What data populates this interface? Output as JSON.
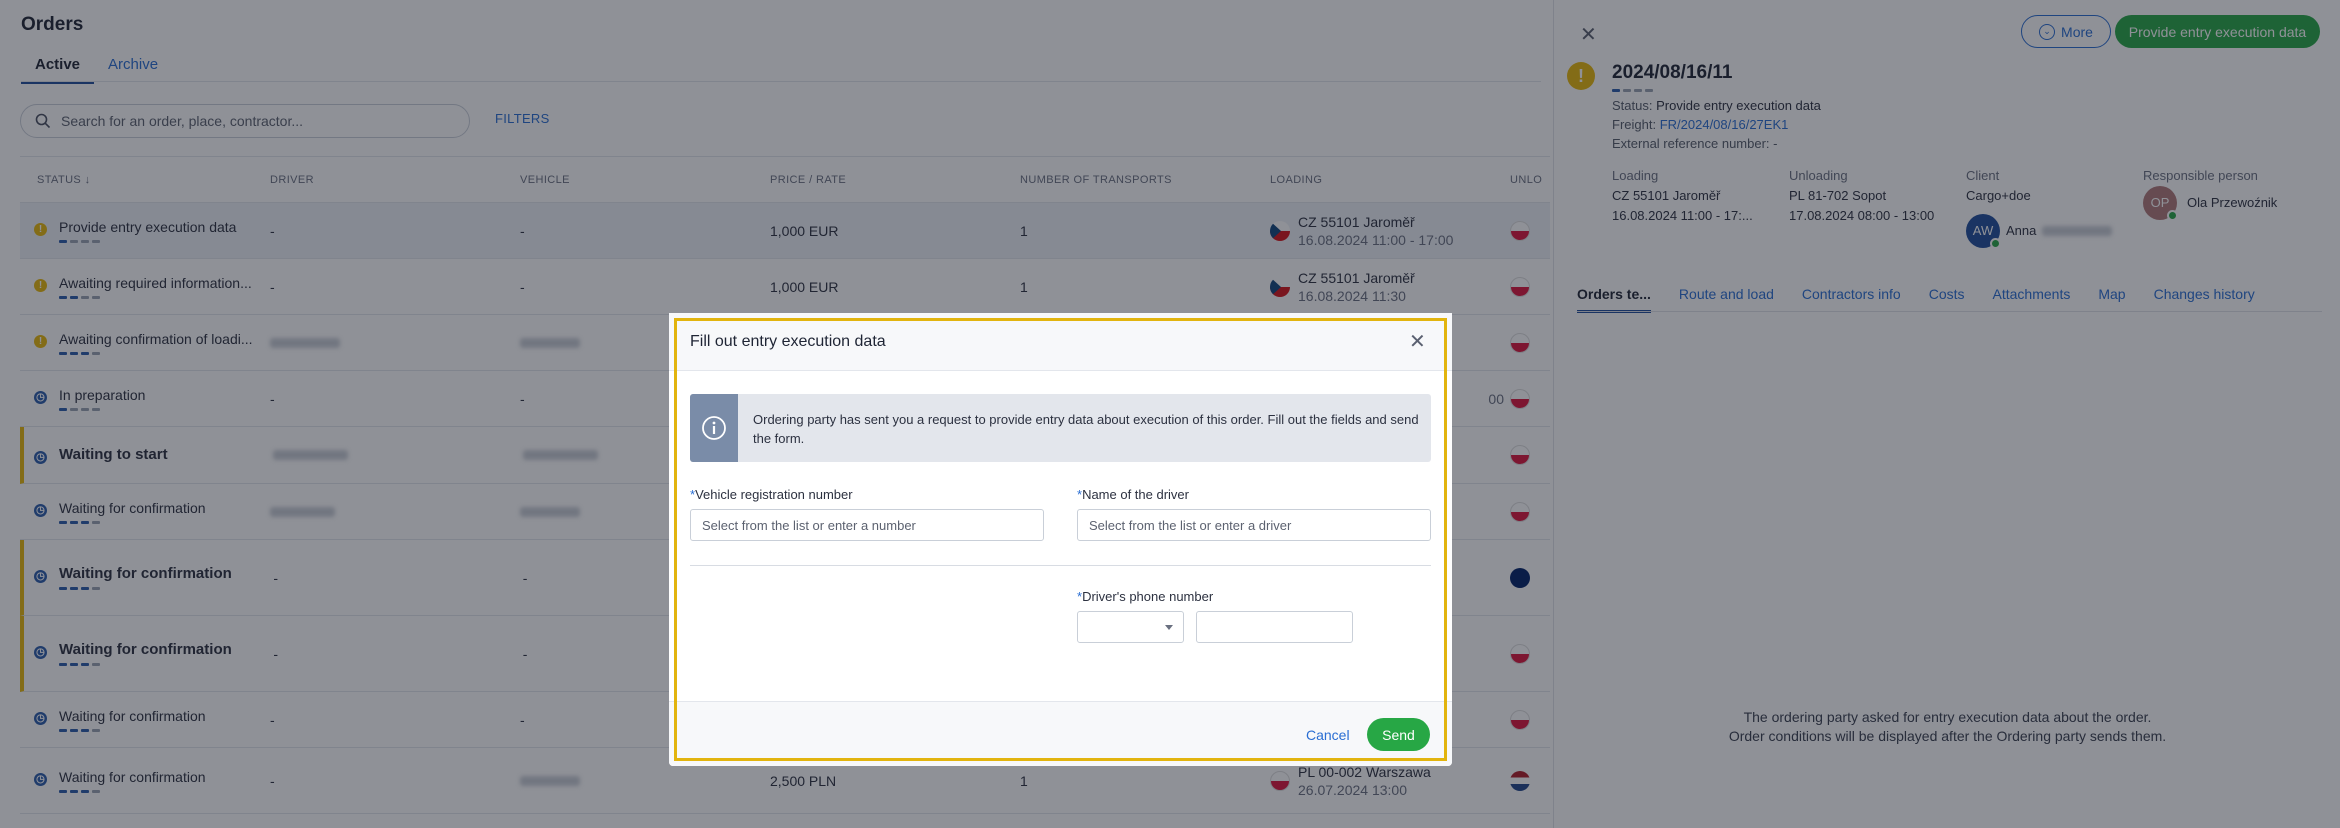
{
  "orders": {
    "title": "Orders",
    "tabs": [
      {
        "label": "Active"
      },
      {
        "label": "Archive"
      }
    ],
    "search_placeholder": "Search for an order, place, contractor...",
    "filters_label": "FILTERS",
    "columns": [
      "STATUS",
      "DRIVER",
      "VEHICLE",
      "PRICE / RATE",
      "NUMBER OF TRANSPORTS",
      "LOADING",
      "UNLO"
    ],
    "rows": [
      {
        "status": "Provide entry execution data",
        "driver": "-",
        "vehicle": "-",
        "price": "1,000 EUR",
        "transports": "1",
        "loading_place": "CZ 55101 Jaroměř",
        "loading_time": "16.08.2024 11:00 - 17:00"
      },
      {
        "status": "Awaiting required information...",
        "driver": "-",
        "vehicle": "-",
        "price": "1,000 EUR",
        "transports": "1",
        "loading_place": "CZ 55101 Jaroměř",
        "loading_time": "16.08.2024 11:30"
      },
      {
        "status": "Awaiting confirmation of loadi...",
        "driver": "",
        "vehicle": "",
        "price": "",
        "transports": "",
        "loading_place": "",
        "loading_time": ""
      },
      {
        "status": "In preparation",
        "driver": "-",
        "vehicle": "-",
        "price": "",
        "transports": "",
        "loading_place": "",
        "loading_time": "00"
      },
      {
        "status": "Waiting to start",
        "driver": "",
        "vehicle": "",
        "price": "",
        "transports": "",
        "loading_place": "",
        "loading_time": ""
      },
      {
        "status": "Waiting for confirmation",
        "driver": "",
        "vehicle": "",
        "price": "",
        "transports": "",
        "loading_place": "",
        "loading_time": ""
      },
      {
        "status": "Waiting for confirmation",
        "driver": "-",
        "vehicle": "-",
        "price": "",
        "transports": "",
        "loading_place": "",
        "loading_time": ""
      },
      {
        "status": "Waiting for confirmation",
        "driver": "-",
        "vehicle": "-",
        "price": "",
        "transports": "",
        "loading_place": "",
        "loading_time": ""
      },
      {
        "status": "Waiting for confirmation",
        "driver": "-",
        "vehicle": "-",
        "price": "",
        "transports": "",
        "loading_place": "",
        "loading_time": ""
      },
      {
        "status": "Waiting for confirmation",
        "driver": "-",
        "vehicle": "",
        "price": "2,500 PLN",
        "transports": "1",
        "loading_place": "PL 00-002 Warszawa",
        "loading_time": "26.07.2024 13:00"
      }
    ]
  },
  "detail": {
    "more_label": "More",
    "provide_label": "Provide entry execution data",
    "order_number": "2024/08/16/11",
    "status_label": "Status:",
    "status_value": "Provide entry execution data",
    "freight_label": "Freight:",
    "freight_value": "FR/2024/08/16/27EK1",
    "extref_label": "External reference number:",
    "extref_value": "-",
    "loading_label": "Loading",
    "loading_place": "CZ 55101 Jaroměř",
    "loading_time": "16.08.2024 11:00 - 17:...",
    "unloading_label": "Unloading",
    "unloading_place": "PL 81-702 Sopot",
    "unloading_time": "17.08.2024 08:00 - 13:00",
    "client_label": "Client",
    "client_value": "Cargo+doe",
    "client_avatar": "AW",
    "client_person": "Anna",
    "responsible_label": "Responsible person",
    "responsible_avatar": "OP",
    "responsible_name": "Ola Przewoźnik",
    "tabs": [
      "Orders te...",
      "Route and load",
      "Contractors info",
      "Costs",
      "Attachments",
      "Map",
      "Changes history"
    ],
    "message_line1": "The ordering party asked for entry execution data about the order.",
    "message_line2": "Order conditions will be displayed after the Ordering party sends them."
  },
  "modal": {
    "title": "Fill out entry execution data",
    "info": "Ordering party has sent you a request to provide entry data about execution of this order. Fill out the fields and send the form.",
    "vehicle_label": "Vehicle registration number",
    "vehicle_placeholder": "Select from the list or enter a number",
    "driver_label": "Name of the driver",
    "driver_placeholder": "Select from the list or enter a driver",
    "phone_label": "Driver's phone number",
    "required_mark": "*",
    "cancel_label": "Cancel",
    "send_label": "Send"
  },
  "colors": {
    "accent_blue": "#2a6ed3",
    "success_green": "#27a745",
    "warning_yellow": "#e8b90b",
    "highlight_frame": "#e2b40e"
  }
}
